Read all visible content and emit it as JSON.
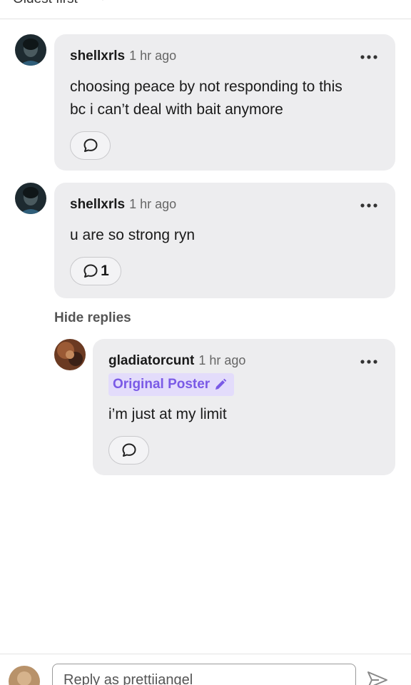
{
  "sort": {
    "label": "Oldest first"
  },
  "comments": [
    {
      "username": "shellxrls",
      "time": "1 hr ago",
      "body_lines": [
        "choosing peace by not responding to this",
        "bc i can’t deal with bait anymore"
      ],
      "reply_count": ""
    },
    {
      "username": "shellxrls",
      "time": "1 hr ago",
      "body_lines": [
        "u are so strong ryn"
      ],
      "reply_count": "1"
    }
  ],
  "hide_replies_label": "Hide replies",
  "reply": {
    "username": "gladiatorcunt",
    "time": "1 hr ago",
    "badge": "Original Poster",
    "body": "i’m just at my limit"
  },
  "composer": {
    "placeholder": "Reply as prettiiangel"
  },
  "colors": {
    "bubble": "#ededef",
    "badge_bg": "#e3dcfb",
    "badge_text": "#7a5ae6"
  },
  "icons": [
    "chevron-down-icon",
    "more-dots-icon",
    "reply-bubble-icon",
    "pencil-icon",
    "send-icon"
  ]
}
